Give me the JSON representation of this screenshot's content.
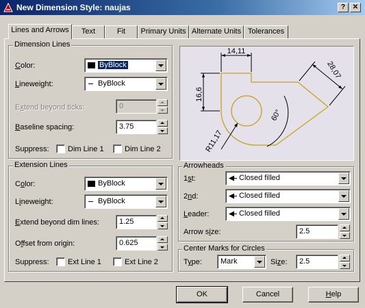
{
  "window": {
    "title": "New Dimension Style: naujas",
    "help_glyph": "?",
    "close_glyph": "✕"
  },
  "tabs": [
    {
      "label": "Lines and Arrows"
    },
    {
      "label": "Text"
    },
    {
      "label": "Fit"
    },
    {
      "label": "Primary Units"
    },
    {
      "label": "Alternate Units"
    },
    {
      "label": "Tolerances"
    }
  ],
  "dimension_lines": {
    "title": "Dimension Lines",
    "color_label": "Color:",
    "color_value": "ByBlock",
    "lineweight_label": "Lineweight:",
    "lineweight_value": "ByBlock",
    "extend_ticks_label": "Extend beyond ticks:",
    "extend_ticks_value": "0",
    "baseline_label": "Baseline spacing:",
    "baseline_value": "3.75",
    "suppress_label": "Suppress:",
    "dim_line1": "Dim Line 1",
    "dim_line2": "Dim Line 2"
  },
  "extension_lines": {
    "title": "Extension Lines",
    "color_label": "Color:",
    "color_value": "ByBlock",
    "lineweight_label": "Lineweight:",
    "lineweight_value": "ByBlock",
    "extend_label": "Extend beyond dim lines:",
    "extend_value": "1.25",
    "offset_label": "Offset from origin:",
    "offset_value": "0.625",
    "suppress_label": "Suppress:",
    "ext_line1": "Ext Line 1",
    "ext_line2": "Ext Line 2"
  },
  "preview": {
    "dim_top": "14,11",
    "dim_left": "16,6",
    "dim_right": "28,07",
    "dim_angle": "60°",
    "dim_radius": "R11,17"
  },
  "arrowheads": {
    "title": "Arrowheads",
    "first_label": "1st:",
    "first_value": "Closed filled",
    "second_label": "2nd:",
    "second_value": "Closed filled",
    "leader_label": "Leader:",
    "leader_value": "Closed filled",
    "size_label": "Arrow size:",
    "size_value": "2.5"
  },
  "center_marks": {
    "title": "Center Marks for Circles",
    "type_label": "Type:",
    "type_value": "Mark",
    "size_label": "Size:",
    "size_value": "2.5"
  },
  "buttons": {
    "ok": "OK",
    "cancel": "Cancel",
    "help": "Help"
  },
  "colors": {
    "title_bar": "#0a246a",
    "face": "#d4d0c8",
    "preview_bg": "#e5e1ea",
    "preview_shape": "#c8a020"
  }
}
